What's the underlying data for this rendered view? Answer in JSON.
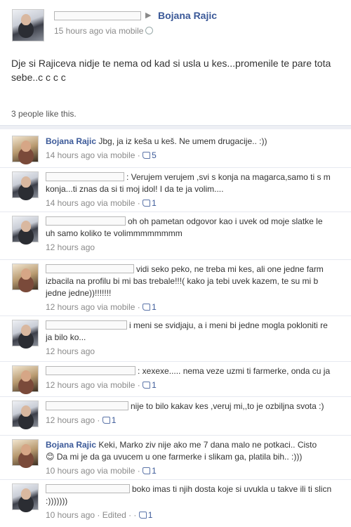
{
  "post": {
    "author": "Bojana Rajic",
    "time": "15 hours ago via mobile",
    "text": "Dje si Rajiceva nidje te nema od kad si usla u kes...promenile te pare tota\nsebe..c c c c",
    "likes": "3 people like this."
  },
  "comments": [
    {
      "author": "Bojana Rajic",
      "text": "Jbg, ja iz keša u keš. Ne umem drugacije.. :))",
      "time": "14 hours ago via mobile",
      "likes": "5",
      "avatar": "female",
      "redacted": false
    },
    {
      "author": "",
      "text": ": Verujem verujem ,svi s konja na magarca,samo ti s m\nkonja...ti znas da si ti moj idol! I da te ja volim....",
      "time": "14 hours ago via mobile",
      "likes": "1",
      "avatar": "male",
      "redacted": true,
      "redact_w": 112
    },
    {
      "author": "",
      "text": "oh oh pametan odgovor kao i uvek od moje slatke le\nuh samo koliko te volimmmmmmmm",
      "time": "12 hours ago",
      "likes": "",
      "avatar": "male",
      "redacted": true,
      "redact_w": 114
    },
    {
      "author": "",
      "text": "vidi seko peko, ne treba mi kes, ali one jedne farm\nizbacila na profilu bi mi bas trebale!!!( kako ja tebi uvek kazem, te su mi b\njedne jedne))!!!!!!!",
      "time": "12 hours ago via mobile",
      "likes": "1",
      "avatar": "female",
      "redacted": true,
      "redact_w": 126
    },
    {
      "author": "",
      "text": "i meni se svidjaju, a i meni bi jedne mogla pokloniti re\nja bilo ko...",
      "time": "12 hours ago",
      "likes": "",
      "avatar": "male",
      "redacted": true,
      "redact_w": 116
    },
    {
      "author": "",
      "text": ": xexexe..... nema veze uzmi ti farmerke, onda cu ja",
      "time": "12 hours ago via mobile",
      "likes": "1",
      "avatar": "female",
      "redacted": true,
      "redact_w": 128
    },
    {
      "author": "",
      "text": "nije to bilo kakav kes ,veruj mi,,to je ozbiljna svota :)",
      "time": "12 hours ago",
      "likes": "1",
      "avatar": "male",
      "redacted": true,
      "redact_w": 118
    },
    {
      "author": "Bojana Rajic",
      "text": "Keki, Marko ziv nije ako me 7 dana malo ne potkaci.. Cisto\n😊 Da mi je da ga uvucem u one farmerke i slikam ga, platila bih.. :)))",
      "time": "10 hours ago via mobile",
      "likes": "1",
      "avatar": "female",
      "redacted": false
    },
    {
      "author": "",
      "text": "boko imas ti njih dosta koje si uvukla u takve ili ti slicn\n:)))))))",
      "time": "10 hours ago · Edited ·",
      "likes": "1",
      "avatar": "male",
      "redacted": true,
      "redact_w": 120
    }
  ]
}
